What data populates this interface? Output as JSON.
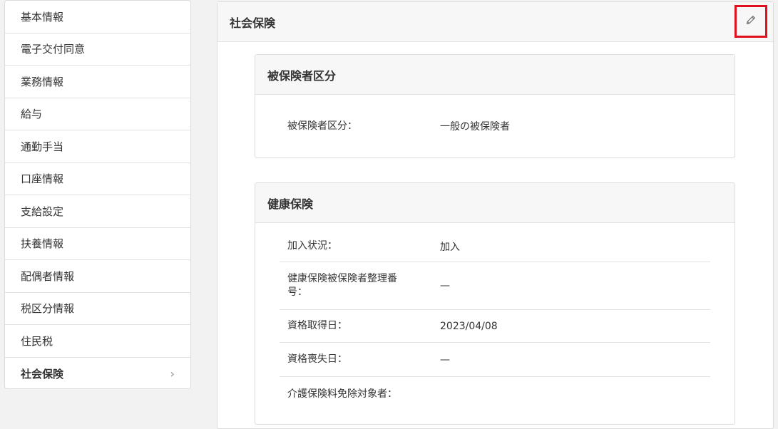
{
  "sidebar": {
    "items": [
      {
        "label": "基本情報"
      },
      {
        "label": "電子交付同意"
      },
      {
        "label": "業務情報"
      },
      {
        "label": "給与"
      },
      {
        "label": "通勤手当"
      },
      {
        "label": "口座情報"
      },
      {
        "label": "支給設定"
      },
      {
        "label": "扶養情報"
      },
      {
        "label": "配偶者情報"
      },
      {
        "label": "税区分情報"
      },
      {
        "label": "住民税"
      },
      {
        "label": "社会保険",
        "active": true
      }
    ],
    "chevron": "›"
  },
  "panel": {
    "title": "社会保険",
    "edit_icon": "pencil-icon"
  },
  "insured": {
    "title": "被保険者区分",
    "rows": [
      {
        "label": "被保険者区分：",
        "value": "一般の被保険者"
      }
    ]
  },
  "health": {
    "title": "健康保険",
    "rows": [
      {
        "label": "加入状況：",
        "value": "加入"
      },
      {
        "label": "健康保険被保険者整理番号：",
        "value": "—"
      },
      {
        "label": "資格取得日：",
        "value": "2023/04/08"
      },
      {
        "label": "資格喪失日：",
        "value": "—"
      },
      {
        "label": "介護保険料免除対象者：",
        "value": ""
      }
    ]
  }
}
